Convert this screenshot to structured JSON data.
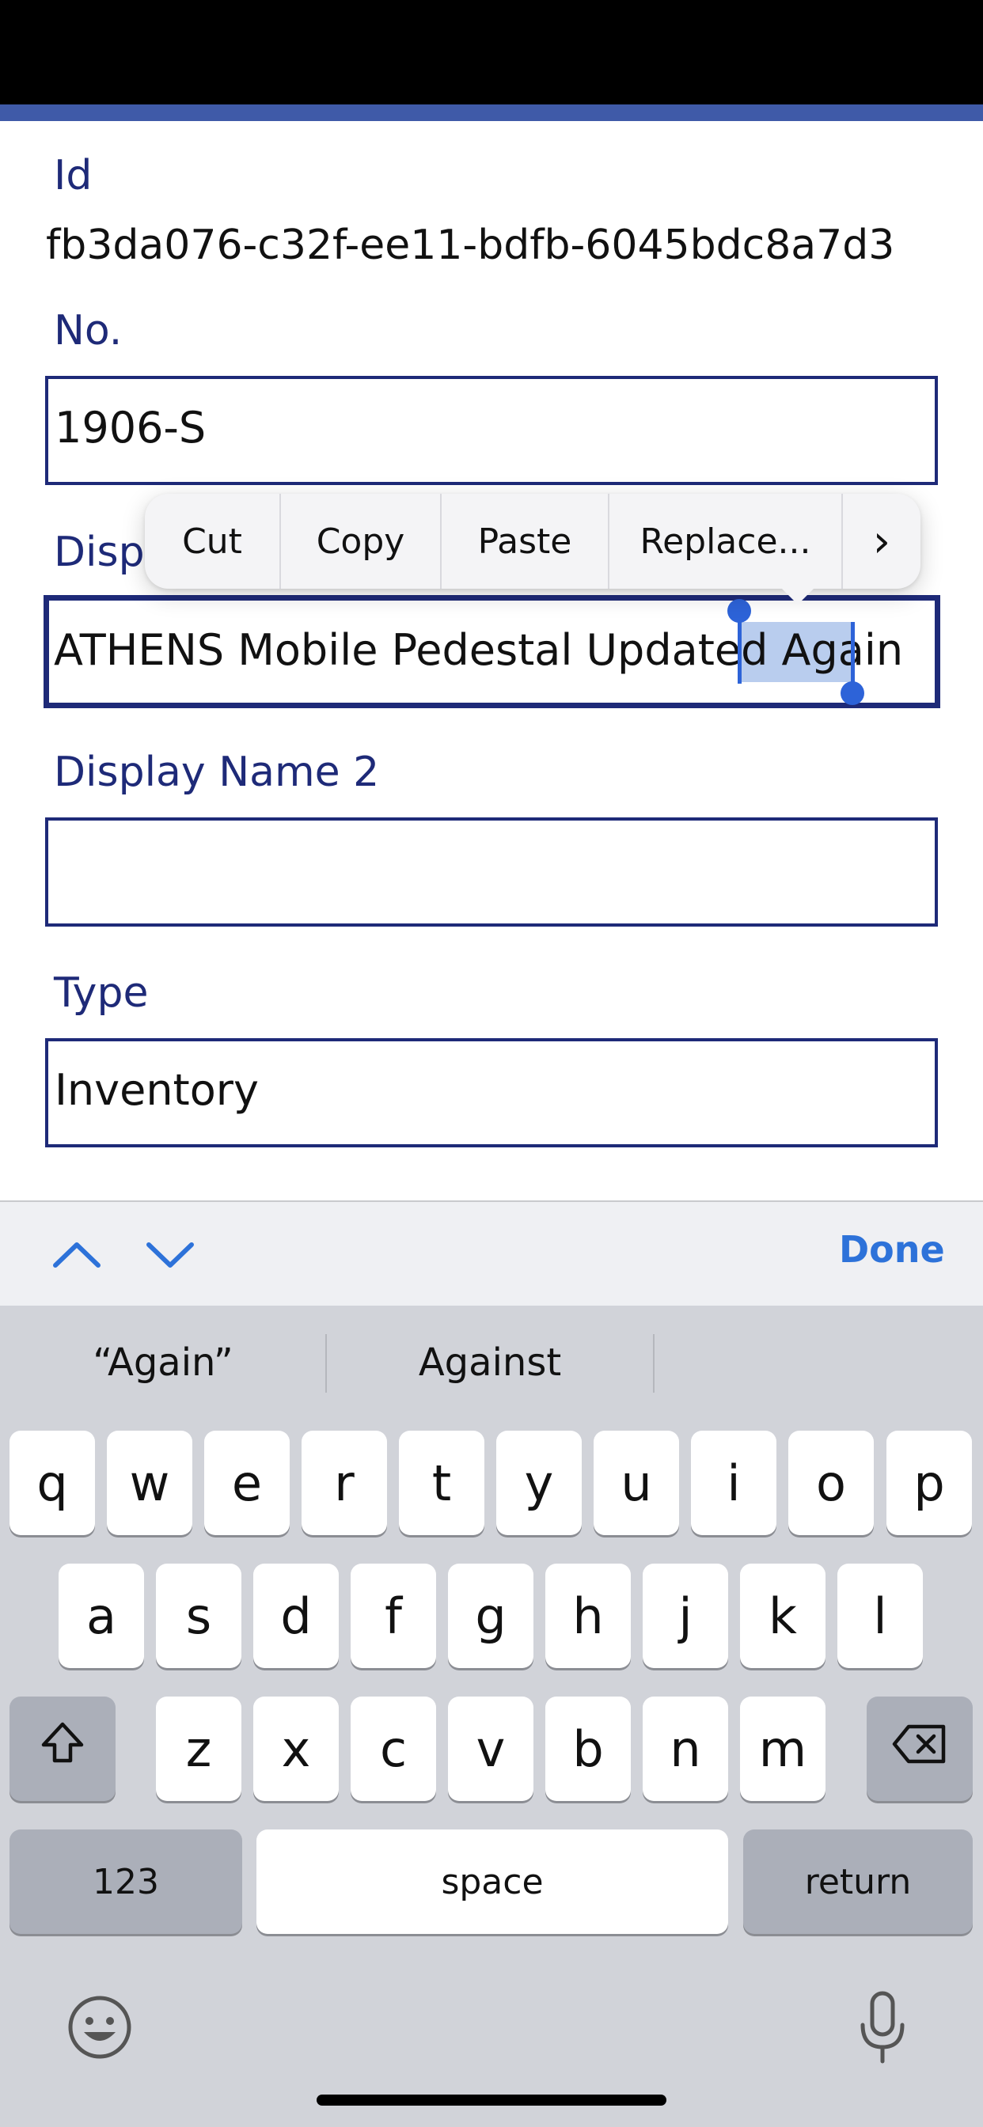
{
  "form": {
    "id_label": "Id",
    "id_value": "fb3da076-c32f-ee11-bdfb-6045bdc8a7d3",
    "no_label": "No.",
    "no_value": "1906-S",
    "display_name_label": "Disp",
    "display_name_value": "ATHENS Mobile Pedestal Updated ",
    "display_name_selected": "Again",
    "display_name2_label": "Display Name 2",
    "display_name2_value": "",
    "type_label": "Type",
    "type_value": "Inventory"
  },
  "edit_menu": {
    "items": [
      "Cut",
      "Copy",
      "Paste",
      "Replace..."
    ],
    "more": "›"
  },
  "accessory": {
    "done_label": "Done",
    "prev_icon": "chevron-up-icon",
    "next_icon": "chevron-down-icon"
  },
  "keyboard": {
    "suggestions": [
      "“Again”",
      "Against"
    ],
    "row1": [
      "q",
      "w",
      "e",
      "r",
      "t",
      "y",
      "u",
      "i",
      "o",
      "p"
    ],
    "row2": [
      "a",
      "s",
      "d",
      "f",
      "g",
      "h",
      "j",
      "k",
      "l"
    ],
    "row3": [
      "z",
      "x",
      "c",
      "v",
      "b",
      "n",
      "m"
    ],
    "numbers_label": "123",
    "space_label": "space",
    "return_label": "return",
    "shift_icon": "shift-icon",
    "backspace_icon": "backspace-icon",
    "emoji_icon": "emoji-icon",
    "mic_icon": "microphone-icon"
  },
  "colors": {
    "label": "#1e2a78",
    "accent_bar": "#3f5aa8",
    "selection": "#2d63d8",
    "done": "#2d72d9"
  }
}
